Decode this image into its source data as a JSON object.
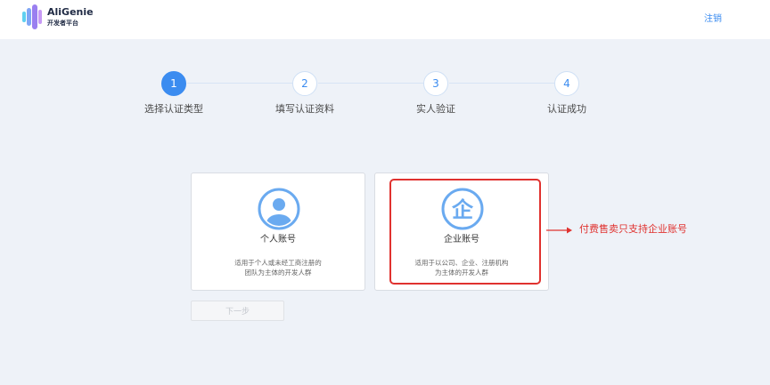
{
  "header": {
    "brand": "AliGenie",
    "brand_sub": "开发者平台",
    "logout_label": "注销"
  },
  "steps": [
    {
      "number": "1",
      "label": "选择认证类型",
      "active": true
    },
    {
      "number": "2",
      "label": "填写认证资料",
      "active": false
    },
    {
      "number": "3",
      "label": "实人验证",
      "active": false
    },
    {
      "number": "4",
      "label": "认证成功",
      "active": false
    }
  ],
  "cards": {
    "personal": {
      "icon": "person-icon",
      "title": "个人账号",
      "desc_line1": "适用于个人或未经工商注册的",
      "desc_line2": "团队为主体的开发人群"
    },
    "enterprise": {
      "icon": "enterprise-icon",
      "icon_char": "企",
      "title": "企业账号",
      "desc_line1": "适用于以公司、企业、注册机构",
      "desc_line2": "为主体的开发人群"
    }
  },
  "annotation": {
    "text": "付费售卖只支持企业账号",
    "color": "#e0322f"
  },
  "actions": {
    "next_label": "下一步"
  },
  "colors": {
    "accent": "#3b8cf0",
    "icon_blue": "#6aaaf0",
    "background": "#eef2f8"
  }
}
